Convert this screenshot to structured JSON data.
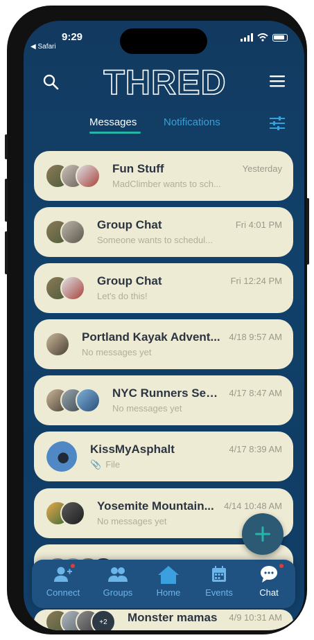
{
  "status": {
    "time": "9:29",
    "back_label": "◀ Safari"
  },
  "app": {
    "logo_text": "THRED"
  },
  "tabs": [
    {
      "label": "Messages"
    },
    {
      "label": "Notifications"
    }
  ],
  "conversations": [
    {
      "title": "Fun Stuff",
      "subtitle": "MadClimber wants to sch...",
      "time": "Yesterday"
    },
    {
      "title": "Group Chat",
      "subtitle": "Someone wants to schedul...",
      "time": "Fri 4:01 PM"
    },
    {
      "title": "Group Chat",
      "subtitle": "Let's do this!",
      "time": "Fri 12:24 PM"
    },
    {
      "title": "Portland Kayak Advent...",
      "subtitle": "No messages yet",
      "time": "4/18 9:57 AM"
    },
    {
      "title": "NYC Runners See...",
      "subtitle": "No messages yet",
      "time": "4/17 8:47 AM"
    },
    {
      "title": "KissMyAsphalt",
      "subtitle": "File",
      "time": "4/17 8:39 AM"
    },
    {
      "title": "Yosemite Mountain...",
      "subtitle": "No messages yet",
      "time": "4/14 10:48 AM"
    },
    {
      "title": "Monster mamas",
      "subtitle": "",
      "time": "4/9 10:31 AM",
      "more_count": "+2"
    }
  ],
  "tabbar": [
    {
      "label": "Connect",
      "icon": "add-user-icon"
    },
    {
      "label": "Groups",
      "icon": "groups-icon"
    },
    {
      "label": "Home",
      "icon": "home-icon"
    },
    {
      "label": "Events",
      "icon": "calendar-icon"
    },
    {
      "label": "Chat",
      "icon": "chat-icon"
    }
  ],
  "colors": {
    "accent": "#26b6a8",
    "card": "#eeebd5",
    "badge": "#e53935"
  }
}
